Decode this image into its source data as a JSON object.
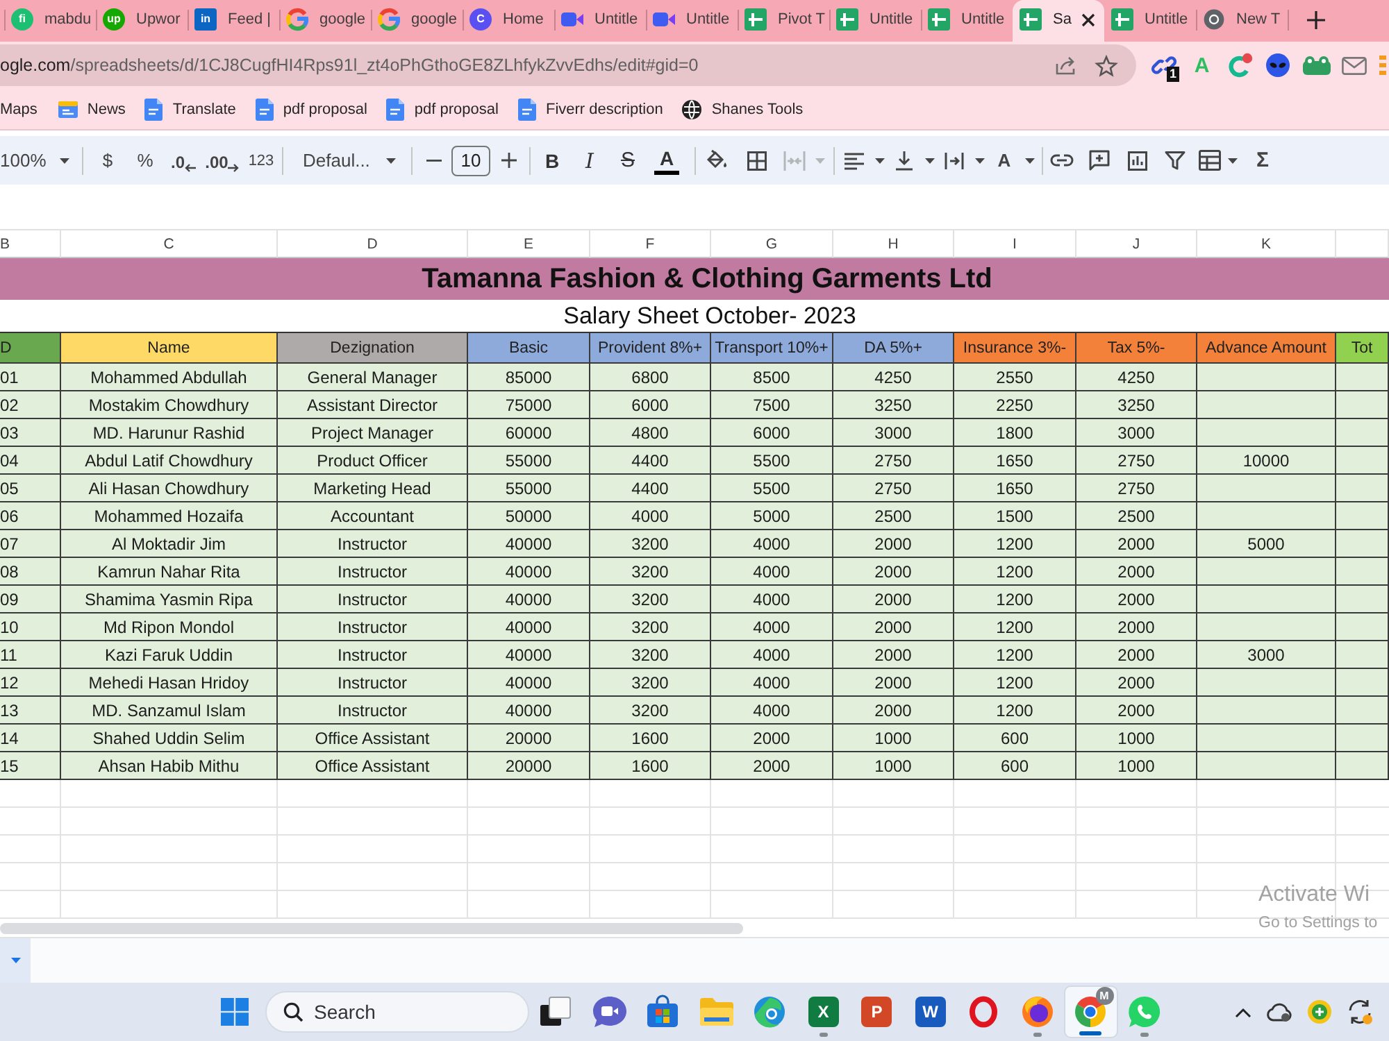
{
  "browser_tabs": [
    {
      "title": "mabdu",
      "kind": "letter-disc",
      "icon_text": "fi",
      "color": "#1dbf73",
      "selected": false
    },
    {
      "title": "Upwor",
      "kind": "letter-disc",
      "icon_text": "up",
      "color": "#14a800",
      "selected": false
    },
    {
      "title": "Feed |",
      "kind": "letter-square",
      "icon_text": "in",
      "color": "#0a66c2",
      "selected": false
    },
    {
      "title": "google",
      "kind": "g-mark",
      "selected": false
    },
    {
      "title": "google",
      "kind": "g-mark",
      "selected": false
    },
    {
      "title": "Home",
      "kind": "letter-disc",
      "icon_text": "C",
      "color": "#5a4ff0",
      "selected": false
    },
    {
      "title": "Untitle",
      "kind": "video",
      "selected": false
    },
    {
      "title": "Untitle",
      "kind": "video",
      "selected": false
    },
    {
      "title": "Pivot T",
      "kind": "sheet",
      "selected": false
    },
    {
      "title": "Untitle",
      "kind": "sheet",
      "selected": false
    },
    {
      "title": "Untitle",
      "kind": "sheet",
      "selected": false
    },
    {
      "title": "Sa",
      "kind": "sheet",
      "selected": true
    },
    {
      "title": "Untitle",
      "kind": "sheet",
      "selected": false
    },
    {
      "title": "New T",
      "kind": "ring",
      "selected": false
    }
  ],
  "address_bar": {
    "host": "ogle.com",
    "path": "/spreadsheets/d/1CJ8CugfHI4Rps91l_zt4oPhGthoGE8ZLhfykZvvEdhs/edit#gid=0"
  },
  "extensions": {
    "link_badge": "1",
    "letter": "A"
  },
  "bookmarks": [
    {
      "label": "Maps",
      "kind": "plain"
    },
    {
      "label": "News",
      "kind": "news"
    },
    {
      "label": "Translate",
      "kind": "doc"
    },
    {
      "label": "pdf proposal",
      "kind": "doc"
    },
    {
      "label": "pdf proposal",
      "kind": "doc"
    },
    {
      "label": "Fiverr description",
      "kind": "doc"
    },
    {
      "label": "Shanes Tools",
      "kind": "globe"
    }
  ],
  "toolbar": {
    "zoom": "100%",
    "currency": "$",
    "percent": "%",
    "decrease_decimal": ".0",
    "increase_decimal": ".00",
    "number_format": "123",
    "font": "Defaul...",
    "font_size": "10",
    "bold": "B",
    "italic": "I",
    "strikethrough": "S",
    "text_color": "A",
    "merge_cells": {
      "disabled": true
    },
    "text_rotation": "A",
    "sum": "Σ"
  },
  "sheet": {
    "column_letters": [
      "B",
      "C",
      "D",
      "E",
      "F",
      "G",
      "H",
      "I",
      "J",
      "K"
    ],
    "title": "Tamanna Fashion & Clothing Garments Ltd",
    "subtitle": "Salary Sheet October- 2023",
    "columns": [
      {
        "label": "D",
        "color": "#6aa84f"
      },
      {
        "label": "Name",
        "color": "#ffd966"
      },
      {
        "label": "Dezignation",
        "color": "#aeaaaa"
      },
      {
        "label": "Basic",
        "color": "#8eaadb"
      },
      {
        "label": "Provident 8%+",
        "color": "#8eaadb"
      },
      {
        "label": "Transport 10%+",
        "color": "#8eaadb"
      },
      {
        "label": "DA 5%+",
        "color": "#8eaadb"
      },
      {
        "label": "Insurance 3%-",
        "color": "#f4813a"
      },
      {
        "label": "Tax 5%-",
        "color": "#f4813a"
      },
      {
        "label": "Advance Amount",
        "color": "#f4813a"
      },
      {
        "label": "Tot",
        "color": "#92d050"
      }
    ],
    "rows": [
      {
        "id": "01",
        "name": "Mohammed Abdullah",
        "designation": "General Manager",
        "basic": "85000",
        "provident": "6800",
        "transport": "8500",
        "da": "4250",
        "insurance": "2550",
        "tax": "4250"
      },
      {
        "id": "02",
        "name": "Mostakim Chowdhury",
        "designation": "Assistant Director",
        "basic": "75000",
        "provident": "6000",
        "transport": "7500",
        "da": "3250",
        "insurance": "2250",
        "tax": "3250"
      },
      {
        "id": "03",
        "name": "MD. Harunur Rashid",
        "designation": "Project Manager",
        "basic": "60000",
        "provident": "4800",
        "transport": "6000",
        "da": "3000",
        "insurance": "1800",
        "tax": "3000"
      },
      {
        "id": "04",
        "name": "Abdul Latif Chowdhury",
        "designation": "Product Officer",
        "basic": "55000",
        "provident": "4400",
        "transport": "5500",
        "da": "2750",
        "insurance": "1650",
        "tax": "2750",
        "advance": "10000"
      },
      {
        "id": "05",
        "name": "Ali Hasan Chowdhury",
        "designation": "Marketing Head",
        "basic": "55000",
        "provident": "4400",
        "transport": "5500",
        "da": "2750",
        "insurance": "1650",
        "tax": "2750"
      },
      {
        "id": "06",
        "name": "Mohammed Hozaifa",
        "designation": "Accountant",
        "basic": "50000",
        "provident": "4000",
        "transport": "5000",
        "da": "2500",
        "insurance": "1500",
        "tax": "2500"
      },
      {
        "id": "07",
        "name": "Al Moktadir Jim",
        "designation": "Instructor",
        "basic": "40000",
        "provident": "3200",
        "transport": "4000",
        "da": "2000",
        "insurance": "1200",
        "tax": "2000",
        "advance": "5000"
      },
      {
        "id": "08",
        "name": "Kamrun Nahar Rita",
        "designation": "Instructor",
        "basic": "40000",
        "provident": "3200",
        "transport": "4000",
        "da": "2000",
        "insurance": "1200",
        "tax": "2000"
      },
      {
        "id": "09",
        "name": "Shamima Yasmin Ripa",
        "designation": "Instructor",
        "basic": "40000",
        "provident": "3200",
        "transport": "4000",
        "da": "2000",
        "insurance": "1200",
        "tax": "2000"
      },
      {
        "id": "10",
        "name": "Md Ripon Mondol",
        "designation": "Instructor",
        "basic": "40000",
        "provident": "3200",
        "transport": "4000",
        "da": "2000",
        "insurance": "1200",
        "tax": "2000"
      },
      {
        "id": "11",
        "name": "Kazi Faruk Uddin",
        "designation": "Instructor",
        "basic": "40000",
        "provident": "3200",
        "transport": "4000",
        "da": "2000",
        "insurance": "1200",
        "tax": "2000",
        "advance": "3000"
      },
      {
        "id": "12",
        "name": "Mehedi Hasan Hridoy",
        "designation": "Instructor",
        "basic": "40000",
        "provident": "3200",
        "transport": "4000",
        "da": "2000",
        "insurance": "1200",
        "tax": "2000"
      },
      {
        "id": "13",
        "name": "MD. Sanzamul Islam",
        "designation": "Instructor",
        "basic": "40000",
        "provident": "3200",
        "transport": "4000",
        "da": "2000",
        "insurance": "1200",
        "tax": "2000"
      },
      {
        "id": "14",
        "name": "Shahed Uddin Selim",
        "designation": "Office Assistant",
        "basic": "20000",
        "provident": "1600",
        "transport": "2000",
        "da": "1000",
        "insurance": "600",
        "tax": "1000"
      },
      {
        "id": "15",
        "name": "Ahsan Habib Mithu",
        "designation": "Office Assistant",
        "basic": "20000",
        "provident": "1600",
        "transport": "2000",
        "da": "1000",
        "insurance": "600",
        "tax": "1000"
      }
    ]
  },
  "taskbar": {
    "search": {
      "placeholder": "Search"
    },
    "apps": [
      {
        "kind": "squares",
        "running": false,
        "selected": false
      },
      {
        "kind": "bubble",
        "running": false,
        "selected": false
      },
      {
        "kind": "bag",
        "running": false,
        "selected": false
      },
      {
        "kind": "folder",
        "running": false,
        "selected": false
      },
      {
        "kind": "swirl",
        "running": false,
        "selected": false
      },
      {
        "kind": "tile",
        "icon_text": "X",
        "color": "#107c41",
        "running": true,
        "selected": false
      },
      {
        "kind": "tile",
        "icon_text": "P",
        "color": "#d24726",
        "running": false,
        "selected": false
      },
      {
        "kind": "tile",
        "icon_text": "W",
        "color": "#185abd",
        "running": false,
        "selected": false
      },
      {
        "kind": "o-ring",
        "running": false,
        "selected": false
      },
      {
        "kind": "flame",
        "running": true,
        "selected": false
      },
      {
        "kind": "wheel",
        "badge": "M",
        "running": true,
        "selected": true
      },
      {
        "kind": "phone",
        "running": true,
        "selected": false
      }
    ]
  },
  "activation_notice": {
    "title": "Activate Wi",
    "hint": "Go to Settings to"
  }
}
